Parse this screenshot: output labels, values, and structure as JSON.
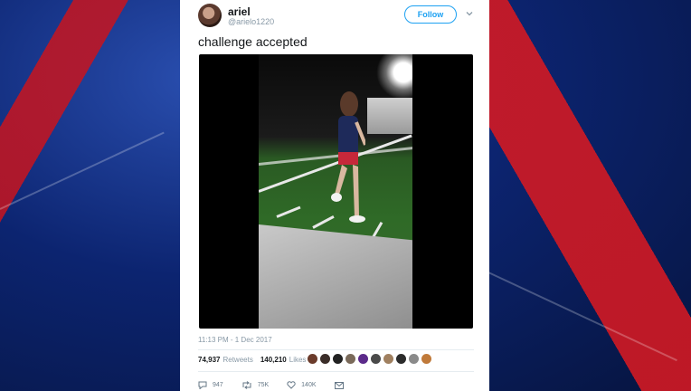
{
  "user": {
    "name": "ariel",
    "handle": "@arielo1220"
  },
  "follow_label": "Follow",
  "tweet_text": "challenge accepted",
  "timestamp": "11:13 PM - 1 Dec 2017",
  "stats": {
    "retweets_count": "74,937",
    "retweets_label": "Retweets",
    "likes_count": "140,210",
    "likes_label": "Likes"
  },
  "actions": {
    "replies": "947",
    "retweets": "75K",
    "likes": "140K"
  },
  "colors": {
    "accent": "#1da1f2",
    "background": "#0b1f5c"
  },
  "icons": [
    "chevron-down-icon",
    "reply-icon",
    "retweet-icon",
    "heart-icon",
    "message-icon"
  ]
}
